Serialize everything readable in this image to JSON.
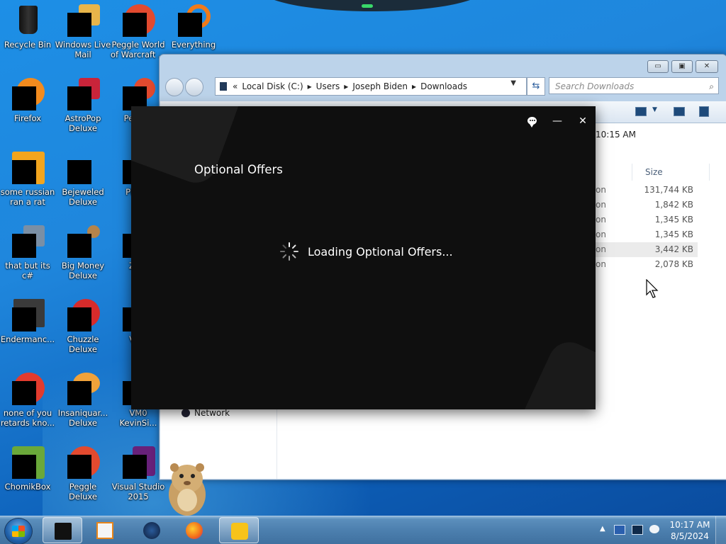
{
  "desktop": {
    "icons": [
      {
        "label": "Recycle Bin"
      },
      {
        "label": "Windows Live Mail"
      },
      {
        "label": "Peggle World of Warcraft ..."
      },
      {
        "label": "Everything"
      },
      {
        "label": "Firefox"
      },
      {
        "label": "AstroPop Deluxe"
      },
      {
        "label": "Pegg D"
      },
      {
        "label": "some russian ran a rat"
      },
      {
        "label": "Bejeweled Deluxe"
      },
      {
        "label": "Pla Zo"
      },
      {
        "label": "that but its c#"
      },
      {
        "label": "Big Money Deluxe"
      },
      {
        "label": "Zum"
      },
      {
        "label": "Endermanc..."
      },
      {
        "label": "Chuzzle Deluxe"
      },
      {
        "label": "V Ke"
      },
      {
        "label": "none of you retards kno..."
      },
      {
        "label": "Insaniquar... Deluxe"
      },
      {
        "label": "VM0 KevinSi..."
      },
      {
        "label": "ChomikBox"
      },
      {
        "label": "Peggle Deluxe"
      },
      {
        "label": "Visual Studio 2015"
      }
    ]
  },
  "explorer": {
    "window_controls": {
      "minimize": "▭",
      "maximize": "▣",
      "close": "✕"
    },
    "address": {
      "prefix": "«",
      "segments": [
        "Local Disk (C:)",
        "Users",
        "Joseph Biden",
        "Downloads"
      ],
      "separator": "▸"
    },
    "search_placeholder": "Search Downloads",
    "date_snippet": "10:15 AM",
    "column_size": "Size",
    "rows": [
      {
        "type": "on",
        "size": "131,744 KB"
      },
      {
        "type": "on",
        "size": "1,842 KB"
      },
      {
        "type": "on",
        "size": "1,345 KB"
      },
      {
        "type": "on",
        "size": "1,345 KB"
      },
      {
        "type": "on",
        "size": "3,442 KB"
      },
      {
        "type": "on",
        "size": "2,078 KB"
      }
    ],
    "nav_network": "Network"
  },
  "dialog": {
    "title": "Optional Offers",
    "loading_text": "Loading Optional Offers...",
    "minimize_glyph": "—",
    "close_glyph": "✕"
  },
  "taskbar": {
    "tray_arrow": "▲",
    "clock_time": "10:17 AM",
    "clock_date": "8/5/2024"
  },
  "colors": {
    "desktop_blue": "#1d8fe6",
    "dialog_bg": "#0f0f0f",
    "taskbar": "#4c7fae"
  },
  "icons": {
    "chat": "chat-bubble-icon",
    "spinner": "loading-spinner-icon",
    "search": "search-icon",
    "refresh": "refresh-icon"
  }
}
